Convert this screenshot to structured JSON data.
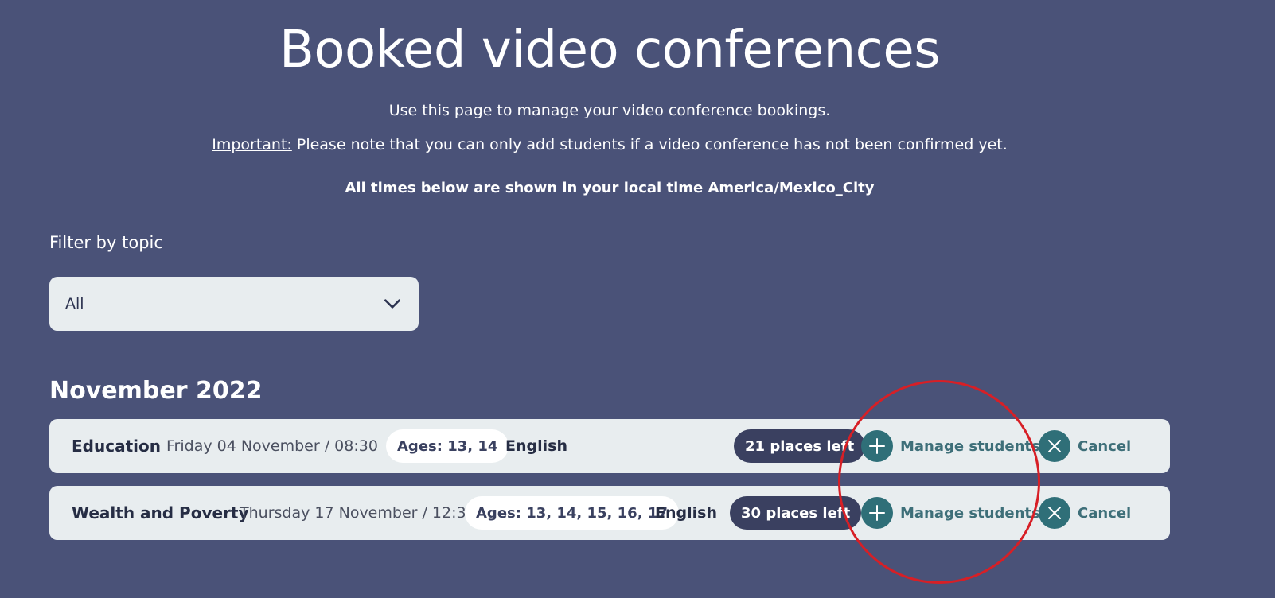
{
  "header": {
    "title": "Booked video conferences",
    "intro": "Use this page to manage your video conference bookings.",
    "important_label": "Important:",
    "important_text": " Please note that you can only add students if a video conference has not been confirmed yet.",
    "timezone_note": "All times below are shown in your local time America/Mexico_City"
  },
  "filter": {
    "label": "Filter by topic",
    "selected": "All"
  },
  "months": [
    {
      "label": "November 2022",
      "bookings": [
        {
          "topic": "Education",
          "datetime": "Friday 04 November / 08:30",
          "ages": "Ages: 13, 14",
          "language": "English",
          "places": "21 places left",
          "manage_label": "Manage students",
          "cancel_label": "Cancel"
        },
        {
          "topic": "Wealth and Poverty",
          "datetime": "Thursday 17 November / 12:30",
          "ages": "Ages: 13, 14, 15, 16, 17",
          "language": "English",
          "places": "30 places left",
          "manage_label": "Manage students",
          "cancel_label": "Cancel"
        }
      ]
    }
  ],
  "colors": {
    "background": "#4a5278",
    "row_background": "#e8edef",
    "action_teal": "#2f6f78",
    "places_badge": "#3a4060",
    "annotation": "#d71f26"
  }
}
